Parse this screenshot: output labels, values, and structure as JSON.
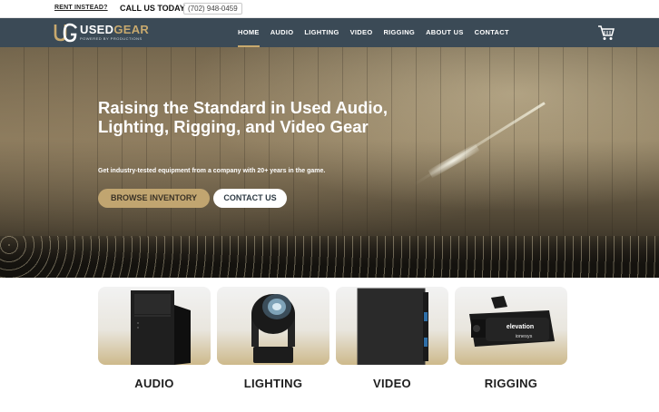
{
  "topbar": {
    "rent_link": "RENT INSTEAD?",
    "call_label": "CALL US TODAY",
    "phone": "(702) 948-0459"
  },
  "brand": {
    "name_part1": "USED",
    "name_part2": "GEAR",
    "tagline": "POWERED BY   PRODUCTIONS",
    "accent_color": "#c8a96e",
    "nav_bg": "#3b4a56"
  },
  "nav": {
    "items": [
      {
        "label": "HOME",
        "active": true
      },
      {
        "label": "AUDIO"
      },
      {
        "label": "LIGHTING"
      },
      {
        "label": "VIDEO"
      },
      {
        "label": "RIGGING"
      },
      {
        "label": "ABOUT US"
      },
      {
        "label": "CONTACT"
      }
    ],
    "cart_icon": "shopping-cart-icon"
  },
  "hero": {
    "title": "Raising the Standard in Used Audio, Lighting, Rigging, and Video Gear",
    "subtitle": "Get industry-tested equipment from a company with 20+ years in the game.",
    "browse_button": "BROWSE INVENTORY",
    "contact_button": "CONTACT US"
  },
  "categories": [
    {
      "label": "AUDIO",
      "icon": "speaker-icon"
    },
    {
      "label": "LIGHTING",
      "icon": "moving-head-light-icon"
    },
    {
      "label": "VIDEO",
      "icon": "led-panel-icon"
    },
    {
      "label": "RIGGING",
      "icon": "truss-clamp-icon"
    }
  ],
  "rigging_product_text": {
    "brand": "elevation",
    "sub": "ionesys"
  }
}
